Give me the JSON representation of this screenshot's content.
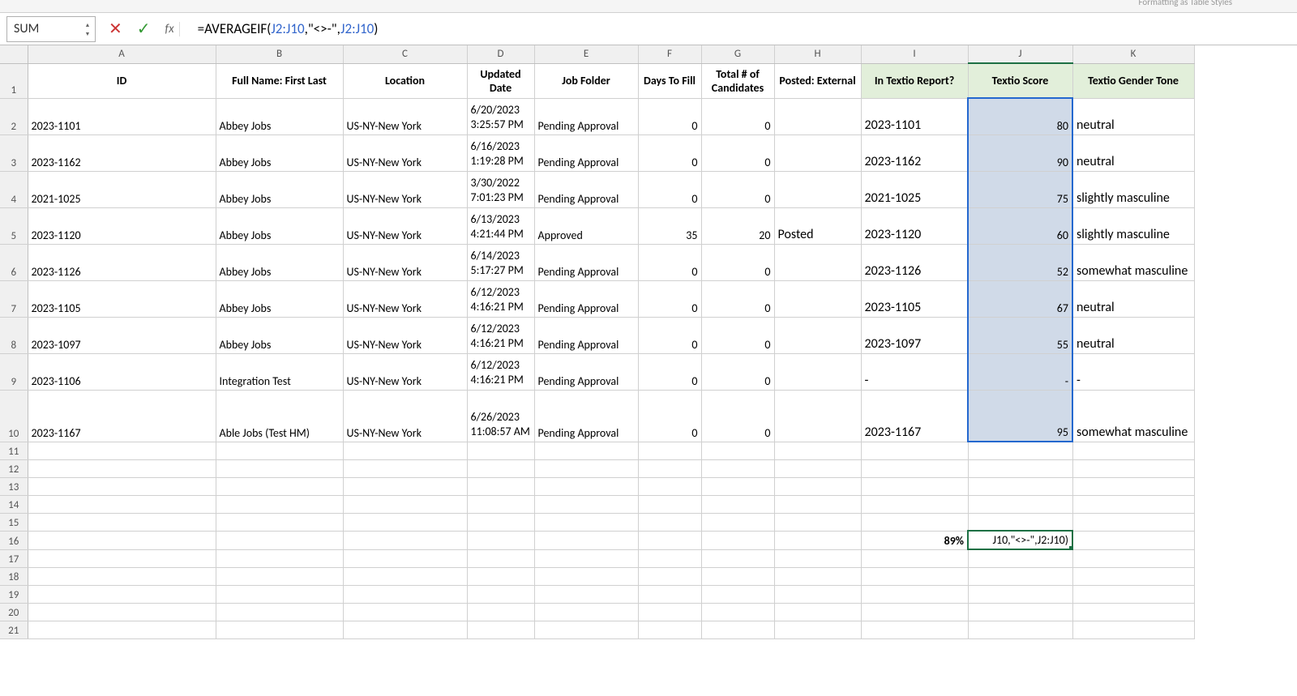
{
  "ribbon": {
    "fragments": "Formatting  as Table   Styles"
  },
  "nameBox": {
    "value": "SUM"
  },
  "formula": {
    "prefix": "=AVERAGEIF(",
    "ref1": "J2:J10",
    "mid": ",\"<>-\",",
    "ref2": "J2:J10",
    "suffix": ")"
  },
  "columns": [
    "A",
    "B",
    "C",
    "D",
    "E",
    "F",
    "G",
    "H",
    "I",
    "J",
    "K"
  ],
  "headers": {
    "A": "ID",
    "B": "Full Name: First Last",
    "C": "Location",
    "D": "Updated Date",
    "E": "Job Folder",
    "F": "Days To Fill",
    "G": "Total # of Candidates",
    "H": "Posted: External",
    "I": "In Textio Report?",
    "J": "Textio Score",
    "K": "Textio Gender Tone"
  },
  "rows": [
    {
      "n": 2,
      "A": "2023-1101",
      "B": "Abbey Jobs",
      "C": "US-NY-New York",
      "D": "6/20/2023 3:25:57 PM",
      "E": "Pending Approval",
      "F": "0",
      "G": "0",
      "H": "",
      "I": "2023-1101",
      "J": "80",
      "K": "neutral"
    },
    {
      "n": 3,
      "A": "2023-1162",
      "B": "Abbey Jobs",
      "C": "US-NY-New York",
      "D": "6/16/2023 1:19:28 PM",
      "E": "Pending Approval",
      "F": "0",
      "G": "0",
      "H": "",
      "I": "2023-1162",
      "J": "90",
      "K": "neutral"
    },
    {
      "n": 4,
      "A": "2021-1025",
      "B": "Abbey Jobs",
      "C": "US-NY-New York",
      "D": "3/30/2022 7:01:23 PM",
      "E": "Pending Approval",
      "F": "0",
      "G": "0",
      "H": "",
      "I": "2021-1025",
      "J": "75",
      "K": "slightly masculine"
    },
    {
      "n": 5,
      "A": "2023-1120",
      "B": "Abbey Jobs",
      "C": "US-NY-New York",
      "D": "6/13/2023 4:21:44 PM",
      "E": "Approved",
      "F": "35",
      "G": "20",
      "H": "Posted",
      "I": "2023-1120",
      "J": "60",
      "K": "slightly masculine"
    },
    {
      "n": 6,
      "A": "2023-1126",
      "B": "Abbey Jobs",
      "C": "US-NY-New York",
      "D": "6/14/2023 5:17:27 PM",
      "E": "Pending Approval",
      "F": "0",
      "G": "0",
      "H": "",
      "I": "2023-1126",
      "J": "52",
      "K": "somewhat masculine"
    },
    {
      "n": 7,
      "A": "2023-1105",
      "B": "Abbey Jobs",
      "C": "US-NY-New York",
      "D": "6/12/2023 4:16:21 PM",
      "E": "Pending Approval",
      "F": "0",
      "G": "0",
      "H": "",
      "I": "2023-1105",
      "J": "67",
      "K": "neutral"
    },
    {
      "n": 8,
      "A": "2023-1097",
      "B": "Abbey Jobs",
      "C": "US-NY-New York",
      "D": "6/12/2023 4:16:21 PM",
      "E": "Pending Approval",
      "F": "0",
      "G": "0",
      "H": "",
      "I": "2023-1097",
      "J": "55",
      "K": "neutral"
    },
    {
      "n": 9,
      "A": "2023-1106",
      "B": "Integration Test",
      "C": "US-NY-New York",
      "D": "6/12/2023 4:16:21 PM",
      "E": "Pending Approval",
      "F": "0",
      "G": "0",
      "H": "",
      "I": "-",
      "J": "-",
      "K": "-"
    },
    {
      "n": 10,
      "A": "2023-1167",
      "B": "Able Jobs (Test HM)",
      "C": "US-NY-New York",
      "D": "6/26/2023 11:08:57 AM",
      "E": "Pending Approval",
      "F": "0",
      "G": "0",
      "H": "",
      "I": "2023-1167",
      "J": "95",
      "K": "somewhat masculine"
    }
  ],
  "summary": {
    "I16": "89%",
    "J16": "J10,\"<>-\",J2:J10)"
  },
  "emptyRowNumbers": [
    11,
    12,
    13,
    14,
    15,
    16,
    17,
    18,
    19,
    20,
    21
  ]
}
